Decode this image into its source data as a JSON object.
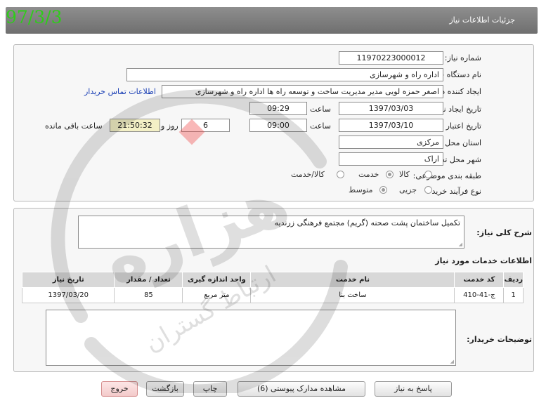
{
  "header": {
    "title": "جزئیات اطلاعات نیاز",
    "date_stamp": "97/3/3"
  },
  "labels": {
    "need_number": "شماره نیاز:",
    "buyer_org": "نام دستگاه خریدار:",
    "requester": "ایجاد کننده درخواست:",
    "created": "تاریخ ایجاد نیاز:",
    "validity": "تاریخ اعتبار نیاز:",
    "province": "استان محل تحویل:",
    "city": "شهر محل تحویل:",
    "category": "طبقه بندی موضوعی:",
    "process": "نوع فرآیند خرید :",
    "time": "ساعت",
    "day_and": "روز و",
    "remaining": "ساعت باقی مانده",
    "description": "شرح کلی نیاز:",
    "services_title": "اطلاعات خدمات مورد نیاز",
    "buyer_notes": "توضیحات خریدار:"
  },
  "fields": {
    "need_number": "1197022300001​2",
    "buyer_org": "اداره راه و شهرسازی",
    "requester": "اصغر حمزه لویی مدیر مدیریت ساخت و توسعه  راه ها اداره راه و شهرسازی",
    "contact_link": "اطلاعات تماس خریدار",
    "created_date": "1397/03/03",
    "created_time": "09:29",
    "validity_date": "1397/03/10",
    "validity_time": "09:00",
    "days": "6",
    "remaining_time": "21:50:32",
    "province": "مرکزی",
    "city": "اراک",
    "description": "تکمیل ساختمان پشت صحنه (گریم) مجتمع فرهنگی زرندیه",
    "buyer_notes": ""
  },
  "category_options": [
    {
      "label": "کالا",
      "selected": false
    },
    {
      "label": "خدمت",
      "selected": true
    },
    {
      "label": "کالا/خدمت",
      "selected": false
    }
  ],
  "process_options": [
    {
      "label": "جزیی",
      "selected": false
    },
    {
      "label": "متوسط",
      "selected": true
    }
  ],
  "table": {
    "headers": [
      "ردیف",
      "کد خدمت",
      "نام خدمت",
      "واحد اندازه گیری",
      "تعداد / مقدار",
      "تاریخ نیاز"
    ],
    "rows": [
      [
        "1",
        "ج-41-410",
        "ساخت بنا",
        "متر مربع",
        "85",
        "1397/03/20"
      ]
    ]
  },
  "buttons": {
    "reply": "پاسخ به نیاز",
    "attachments": "مشاهده مدارک پیوستی (6)",
    "print": "چاپ",
    "back": "بازگشت",
    "exit": "خروج"
  },
  "watermark": {
    "logo_text": "هزاره",
    "sub_text": "ارتباط گستران"
  },
  "colors": {
    "header_bg": "#7d7d7d",
    "date_stamp": "#2ecc1a",
    "link": "#1a3fb5",
    "time_box": "#f3f0c6",
    "exit_button": "#f3caca"
  }
}
